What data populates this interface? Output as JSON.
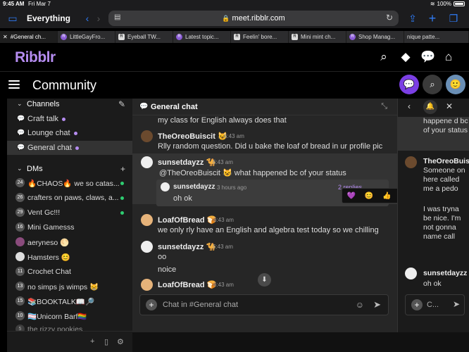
{
  "status": {
    "time": "9:45 AM",
    "date": "Fri Mar 7",
    "battery": "100%"
  },
  "browser": {
    "tab_group": "Everything",
    "url": "meet.ribblr.com",
    "tabs": [
      {
        "label": "#General ch..."
      },
      {
        "label": "LittleGayFro..."
      },
      {
        "label": "Eyeball TW..."
      },
      {
        "label": "Latest topic..."
      },
      {
        "label": "Feelin' bore..."
      },
      {
        "label": "Mini mint ch..."
      },
      {
        "label": "Shop Manag..."
      },
      {
        "label": "nique patte..."
      }
    ]
  },
  "header": {
    "logo": "Ribblr"
  },
  "community": {
    "title": "Community"
  },
  "sidebar": {
    "channels_label": "Channels",
    "channels": [
      {
        "name": "Craft talk"
      },
      {
        "name": "Lounge chat"
      },
      {
        "name": "General chat"
      }
    ],
    "dms_label": "DMs",
    "dms": [
      {
        "avatar": "24",
        "name": "🔥CHAOS🔥 we so catas..."
      },
      {
        "avatar": "26",
        "name": "crafters on paws, claws, a..."
      },
      {
        "avatar": "29",
        "name": "Vent Gc!!!"
      },
      {
        "avatar": "16",
        "name": "Mini Gamesss"
      },
      {
        "avatar": "",
        "name": "aeryneso 🌕"
      },
      {
        "avatar": "",
        "name": "Hamsters 😊"
      },
      {
        "avatar": "11",
        "name": "Crochet Chat"
      },
      {
        "avatar": "13",
        "name": "no simps js wimps 😸"
      },
      {
        "avatar": "15",
        "name": "📚BOOKTALK📖🔎"
      },
      {
        "avatar": "10",
        "name": "🏳️‍⚧️Unicorn Barf🏳️‍🌈"
      },
      {
        "avatar": "5",
        "name": "the rizzy pookies"
      }
    ]
  },
  "chat": {
    "title": "General chat",
    "prev_text": "my class for English always does that",
    "messages": [
      {
        "author": "TheOreoBuiscit 😺",
        "time": "6:43 am",
        "text": "Rlly random question. Did u bake the loaf of bread in ur profile pic"
      },
      {
        "author": "sunsetdayzz 🐪",
        "time": "6:43 am",
        "text": "@TheOreoBuiscit 😺  what happened bc of your status"
      },
      {
        "author": "LoafOfBread 🍞",
        "time": "6:43 am",
        "text": "we only rly have an English and algebra test today so we chilling"
      },
      {
        "author": "sunsetdayzz 🐪",
        "time": "6:43 am",
        "text": "oo"
      },
      {
        "author": "",
        "time": "",
        "text": "noice"
      },
      {
        "author": "LoafOfBread 🍞",
        "time": "6:43 am",
        "text": ""
      }
    ],
    "reply": {
      "author": "sunsetdayzz",
      "time": "3 hours ago",
      "text": "oh ok",
      "count": "2 replies"
    },
    "reactions": [
      "💜",
      "😊",
      "👍",
      "⚙",
      "🔖",
      "↩",
      "⋮"
    ],
    "composer_placeholder": "Chat in #General chat"
  },
  "thread": {
    "snippet": "happene d bc of your status",
    "messages": [
      {
        "author": "TheOreoBuis",
        "text": "Someone on here called me a pedo"
      },
      {
        "author": "",
        "text": "I was tryna be nice. I'm not gonna name call"
      },
      {
        "author": "sunsetdayzz",
        "text": "oh ok"
      }
    ],
    "composer_placeholder": "C..."
  }
}
